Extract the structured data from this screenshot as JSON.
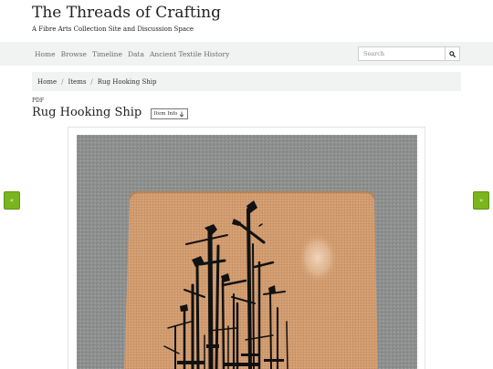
{
  "site": {
    "title": "The Threads of Crafting",
    "tagline": "A Fibre Arts Collection Site and Discussion Space"
  },
  "nav": {
    "items": [
      "Home",
      "Browse",
      "Timeline",
      "Data",
      "Ancient Textile History"
    ]
  },
  "search": {
    "placeholder": "Search",
    "icon": "search-icon"
  },
  "breadcrumb": {
    "items": [
      "Home",
      "Items",
      "Rug Hooking Ship"
    ],
    "separator": "/"
  },
  "item": {
    "format_label": "PDF",
    "title": "Rug Hooking Ship",
    "info_button_label": "Item Info",
    "info_button_icon": "arrow-down-icon"
  },
  "viewer": {
    "prev_label": "«",
    "next_label": "»",
    "image_subject": "hooked rug with abstract ship masts in black on tan, on grey carpet"
  },
  "colors": {
    "nav_bg": "#f1f2f2",
    "accent_green": "#7ab51d",
    "rug_tan": "#cf9a6e",
    "carpet_grey": "#8e8f8f"
  }
}
